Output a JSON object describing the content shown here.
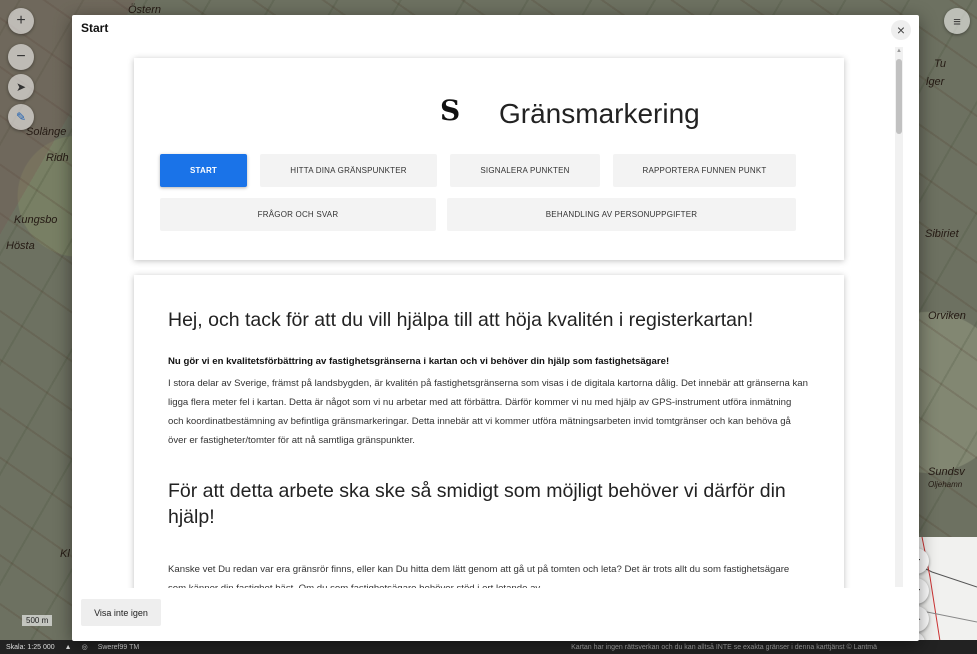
{
  "map": {
    "labels": [
      "Solänge",
      "Ridh",
      "Kungsbo",
      "Hösta",
      "Sibiriet",
      "Orviken",
      "Sundsv",
      "Oljehamn",
      "Tu",
      "Kl",
      "Östern",
      "lger"
    ],
    "scale_label": "Skala: 1:25 000",
    "scale_bar": "500 m",
    "crs": "Sweref99 TM",
    "disclaimer": "Kartan har ingen rättsverkan och du kan alltså INTE se exakta gränser i denna karttjänst © Lantmä",
    "zoom_in": "+",
    "zoom_out": "−"
  },
  "modal": {
    "title": "Start",
    "close": "×",
    "brand": "Gränsmarkering",
    "logo": "S",
    "nav": [
      "START",
      "HITTA DINA GRÄNSPUNKTER",
      "SIGNALERA PUNKTEN",
      "RAPPORTERA FUNNEN PUNKT",
      "FRÅGOR OCH SVAR",
      "BEHANDLING AV PERSONUPPGIFTER"
    ],
    "heading": "Hej, och tack för att du vill hjälpa till att höja kvalitén i registerkartan!",
    "lead": "Nu gör vi en kvalitetsförbättring av fastighetsgränserna i kartan och vi behöver din hjälp som fastighetsägare!",
    "paragraph": "I stora delar av Sverige, främst på landsbygden, är kvalitén på fastighetsgränserna som visas i de digitala kartorna dålig. Det innebär att gränserna kan ligga flera meter fel i kartan. Detta är något som vi nu arbetar med att förbättra. Därför kommer vi nu med hjälp av GPS-instrument utföra inmätning och koordinatbestämning av befintliga gränsmarkeringar. Detta innebär att vi kommer utföra mätningsarbeten invid tomtgränser och kan behöva gå över er fastigheter/tomter för att nå samtliga gränspunkter.",
    "subheading": "För att detta arbete ska ske så smidigt som möjligt behöver vi därför din hjälp!",
    "paragraph2": "Kanske vet Du redan var era gränsrör finns, eller kan Du hitta dem lätt genom att gå ut på tomten och leta? Det är trots allt du som fastighetsägare som känner din fastighet bäst. Om du som fastighetsägare behöver stöd i ert letande av",
    "footer_button": "Visa inte igen"
  }
}
